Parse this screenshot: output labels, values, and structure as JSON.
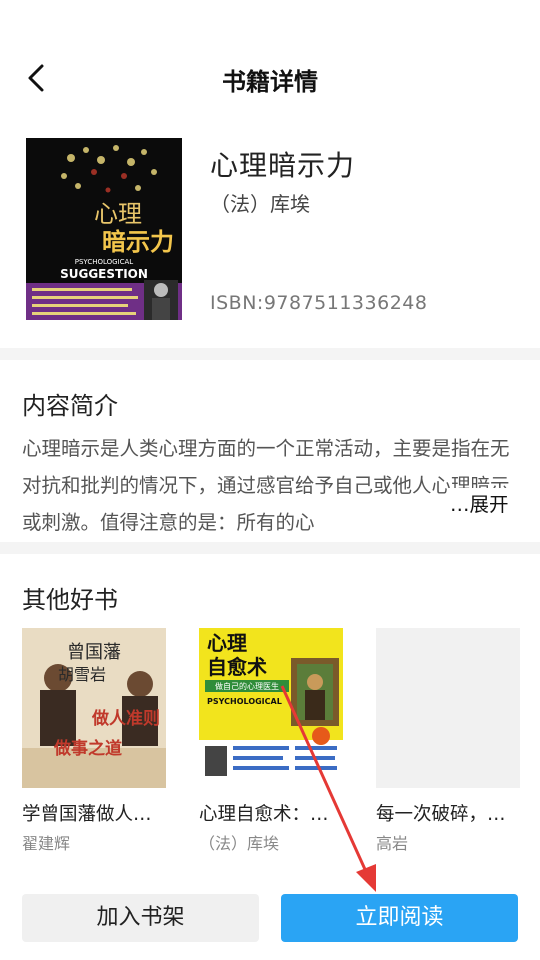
{
  "header": {
    "title": "书籍详情"
  },
  "book": {
    "title": "心理暗示力",
    "author": "（法）库埃",
    "isbn": "ISBN:9787511336248",
    "cover": {
      "title_line1": "心理",
      "title_line2": "暗示力",
      "subtitle_en1": "PSYCHOLOGICAL",
      "subtitle_en2": "SUGGESTION"
    }
  },
  "intro": {
    "heading": "内容简介",
    "text": "心理暗示是人类心理方面的一个正常活动，主要是指在无对抗和批判的情况下，通过感官给予自己或他人心理暗示或刺激。值得注意的是：所有的心",
    "ellipsis": "…",
    "expand_label": "展开"
  },
  "recommend": {
    "heading": "其他好书",
    "items": [
      {
        "title": "学曾国藩做人…",
        "author": "翟建辉",
        "cover_text1": "曾国藩",
        "cover_text2": "胡雪岩",
        "cover_text3": "做人准则",
        "cover_text4": "做事之道"
      },
      {
        "title": "心理自愈术：…",
        "author": "（法）库埃",
        "cover_text1": "心理",
        "cover_text2": "自愈术",
        "cover_text3": "做自己的心理医生",
        "cover_text4": "PSYCHOLOGICAL"
      },
      {
        "title": "每一次破碎，…",
        "author": "高岩"
      }
    ]
  },
  "actions": {
    "add_shelf_label": "加入书架",
    "read_label": "立即阅读"
  },
  "colors": {
    "accent": "#2aa4f4",
    "annotation_arrow": "#e53935"
  }
}
